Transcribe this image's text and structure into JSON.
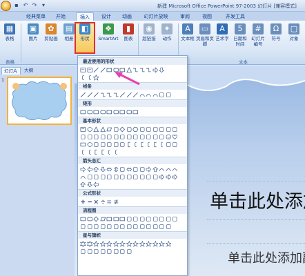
{
  "titlebar": {
    "title": "新建 Microsoft Office PowerPoint 97-2003 幻灯片 [兼容模式]"
  },
  "tabs": [
    {
      "label": "经典菜单"
    },
    {
      "label": "开始"
    },
    {
      "label": "插入",
      "active": true
    },
    {
      "label": "设计"
    },
    {
      "label": "动画"
    },
    {
      "label": "幻灯片放映"
    },
    {
      "label": "审阅"
    },
    {
      "label": "视图"
    },
    {
      "label": "开发工具"
    }
  ],
  "ribbon": {
    "buttons": [
      {
        "label": "表格",
        "icon": "table-icon",
        "color": "#3c73b6"
      },
      {
        "label": "图片",
        "icon": "picture-icon",
        "color": "#4a8cc2"
      },
      {
        "label": "剪贴画",
        "icon": "clipart-icon",
        "color": "#d9862c"
      },
      {
        "label": "相册",
        "icon": "album-icon",
        "color": "#6aa0cf"
      },
      {
        "label": "形状",
        "icon": "shapes-icon",
        "color": "#3f86c9"
      },
      {
        "label": "SmartArt",
        "icon": "smartart-icon",
        "color": "#3a9a4a"
      },
      {
        "label": "图表",
        "icon": "chart-icon",
        "color": "#c0392b"
      },
      {
        "label": "超链接",
        "icon": "hyperlink-icon",
        "color": "#9fb3cc"
      },
      {
        "label": "动作",
        "icon": "action-icon",
        "color": "#9fb3cc"
      },
      {
        "label": "文本框",
        "icon": "textbox-icon",
        "color": "#4f7fb8"
      },
      {
        "label": "页眉和页脚",
        "icon": "header-footer-icon",
        "color": "#6b8fbd"
      },
      {
        "label": "艺术字",
        "icon": "wordart-icon",
        "color": "#2f6db5"
      },
      {
        "label": "日期和时间",
        "icon": "datetime-icon",
        "color": "#6b8fbd"
      },
      {
        "label": "幻灯片编号",
        "icon": "slide-number-icon",
        "color": "#6b8fbd"
      },
      {
        "label": "符号",
        "icon": "symbol-icon",
        "color": "#6b8fbd"
      },
      {
        "label": "对象",
        "icon": "object-icon",
        "color": "#6b8fbd"
      }
    ],
    "groups": [
      {
        "label": "表格"
      },
      {
        "label": "文本"
      }
    ]
  },
  "leftpanel": {
    "tabs": [
      {
        "label": "幻灯片"
      },
      {
        "label": "大纲"
      }
    ],
    "slide_number": "1"
  },
  "gallery": {
    "sections": [
      {
        "title": "最近使用的形状"
      },
      {
        "title": "线条"
      },
      {
        "title": "矩形"
      },
      {
        "title": "基本形状"
      },
      {
        "title": "箭头总汇"
      },
      {
        "title": "公式形状"
      },
      {
        "title": "流程图"
      },
      {
        "title": "星与旗帜"
      }
    ]
  },
  "slide": {
    "heading": "单击此处添加标题",
    "subheading": "单击此处添加副标题"
  },
  "colors": {
    "accent": "#e0302a",
    "highlight": "#f7c85c",
    "pointer_arrow": "#e83fb0"
  }
}
